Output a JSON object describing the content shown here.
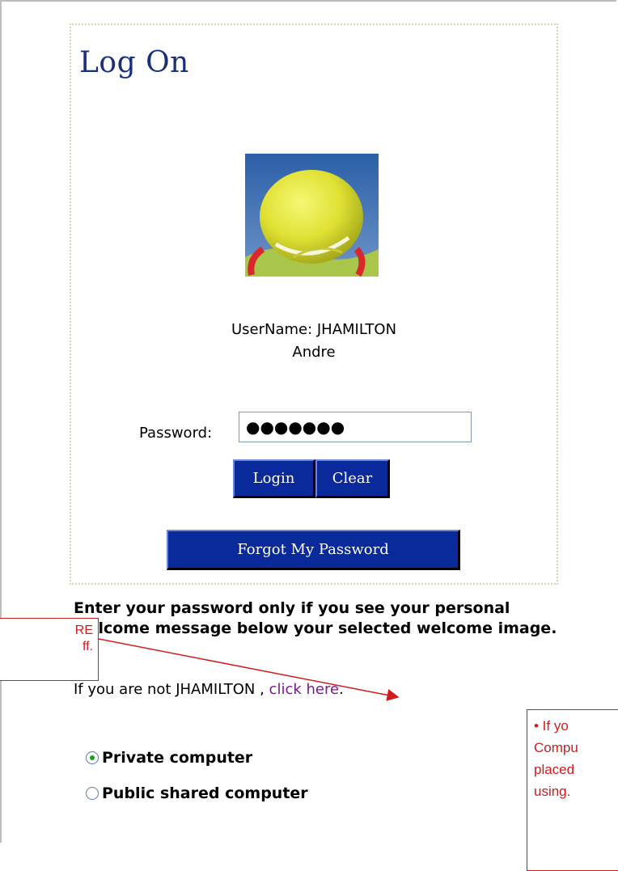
{
  "logon": {
    "title": "Log On",
    "username_line": "UserName: JHAMILTON",
    "display_name": "Andre",
    "password_label": "Password:",
    "password_value": "●●●●●●●",
    "login_button": "Login",
    "clear_button": "Clear",
    "forgot_button": "Forgot My Password",
    "welcome_image_icon": "tennis-ball-image"
  },
  "instructions": "Enter your password only if you see your personal welcome message below your selected welcome image.",
  "not_user": {
    "prefix": "If you are not JHAMILTON , ",
    "link": "click here",
    "suffix": "."
  },
  "computer_options": [
    {
      "label": "Private computer",
      "selected": true
    },
    {
      "label": "Public shared computer",
      "selected": false
    }
  ],
  "callouts": {
    "left_line1": "RE",
    "left_line2": "ff.",
    "right_lines": [
      "• If yo",
      "Compu",
      "placed",
      "using."
    ]
  },
  "colors": {
    "title": "#1a2f7a",
    "button_bg": "#0a2a9c",
    "link": "#7a1a8a",
    "callout": "#d21b1b"
  }
}
